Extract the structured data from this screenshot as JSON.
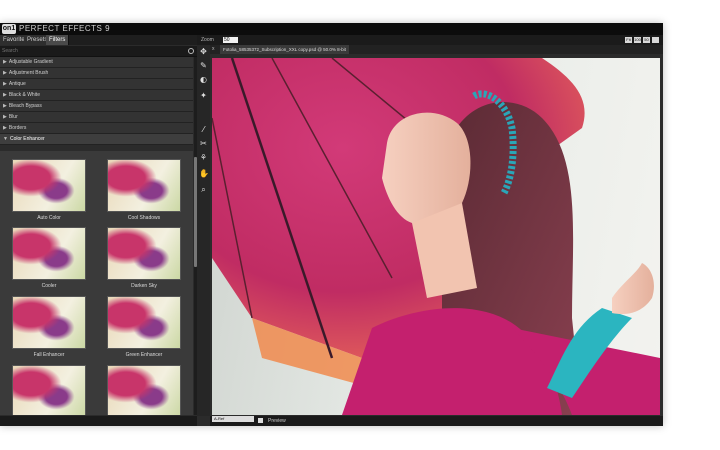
{
  "app": {
    "logo": "on1",
    "title": "PERFECT EFFECTS 9"
  },
  "tabs": [
    {
      "label": "Favorites"
    },
    {
      "label": "Presets"
    },
    {
      "label": "Filters"
    }
  ],
  "search": {
    "placeholder": "Search"
  },
  "categories": [
    {
      "label": "Adjustable Gradient"
    },
    {
      "label": "Adjustment Brush"
    },
    {
      "label": "Antique"
    },
    {
      "label": "Black & White"
    },
    {
      "label": "Bleach Bypass"
    },
    {
      "label": "Blur"
    },
    {
      "label": "Borders"
    },
    {
      "label": "Color Enhancer"
    }
  ],
  "presets": [
    {
      "label": "Auto Color"
    },
    {
      "label": "Cool Shadows"
    },
    {
      "label": "Cooler"
    },
    {
      "label": "Darken Sky"
    },
    {
      "label": "Fall Enhancer"
    },
    {
      "label": "Green Enhancer"
    },
    {
      "label": ""
    },
    {
      "label": ""
    }
  ],
  "toolbar": {
    "zoom_label": "Zoom",
    "zoom_value": "50",
    "view_buttons": [
      "Fit",
      "100",
      "50",
      ""
    ]
  },
  "document": {
    "close": "x",
    "tab_label": "Fotolia_58535372_Subscription_XXL copy.psd @ 50.0% 8-bit"
  },
  "status": {
    "mode": "A-Ref",
    "preview_label": "Preview"
  },
  "colors": {
    "accent": "#c4306a",
    "panel": "#2b2b2b"
  }
}
